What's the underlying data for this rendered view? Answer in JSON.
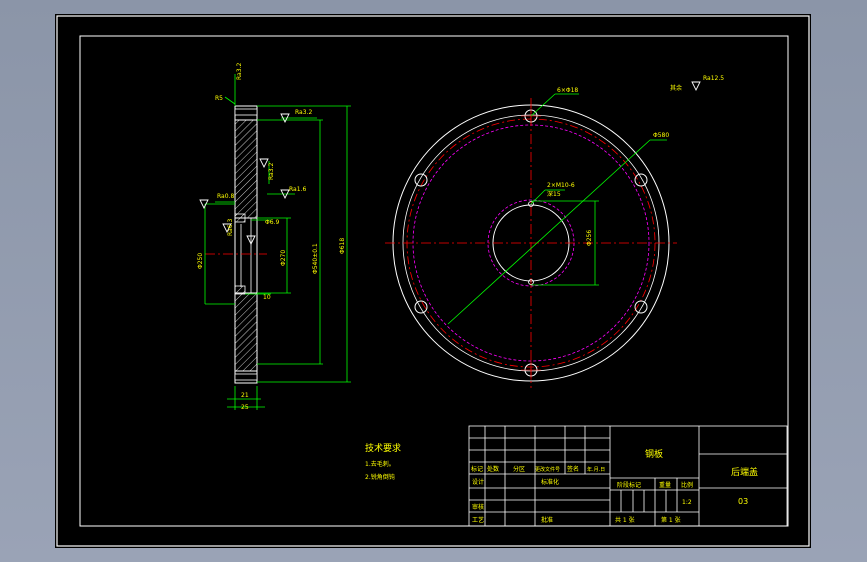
{
  "drawing": {
    "background": "#000000",
    "colors": {
      "outline": "#ffffff",
      "dimension": "#00ff00",
      "centerline": "#ff0000",
      "hidden": "#ff00ff",
      "text": "#ffff00",
      "frame": "#ffffff",
      "hatch": "#ffffff"
    },
    "section_view": {
      "dims": {
        "top_size": "Ra3.2",
        "face_finish": "Ra3.2",
        "chamfer": "R5",
        "groove_finish": "Ra3.2",
        "inner_finish": "Ra1.6",
        "bore_finish": "Ra0.8",
        "outer_finish": "Ra6.3",
        "width_inner": "21",
        "width_total": "25",
        "step": "10",
        "dia_outer": "Φ618",
        "dia_pcd": "Φ540±0.1",
        "dia_bore": "Φ270",
        "dia_inner": "Φ250",
        "dia_groove": "Φ6.9"
      }
    },
    "plan_view": {
      "holes_label": "6×Φ18",
      "pcd_label": "Φ580",
      "tapped_label": "2×M10-6",
      "tapped_depth": "深15",
      "bore_label": "Φ256",
      "rest_finish_prefix": "其余",
      "rest_finish": "Ra12.5"
    },
    "notes": {
      "title": "技术要求",
      "items": [
        "1.去毛刺。",
        "2.锐角倒钝"
      ]
    },
    "title_block": {
      "part_name": "钢板",
      "drawing_name": "后端盖",
      "drawing_no": "03",
      "header_cells": [
        "标记",
        "处数",
        "分区",
        "更改文件号",
        "签名",
        "年.月.日"
      ],
      "labels": {
        "design": "设计",
        "standardize": "标准化",
        "review": "审核",
        "process": "工艺",
        "approve": "批准",
        "stage": "阶段标记",
        "weight": "重量",
        "scale": "比例",
        "scale_value": "1:2",
        "sheets": "共  1  张",
        "sheet_no": "第  1  张"
      }
    }
  }
}
